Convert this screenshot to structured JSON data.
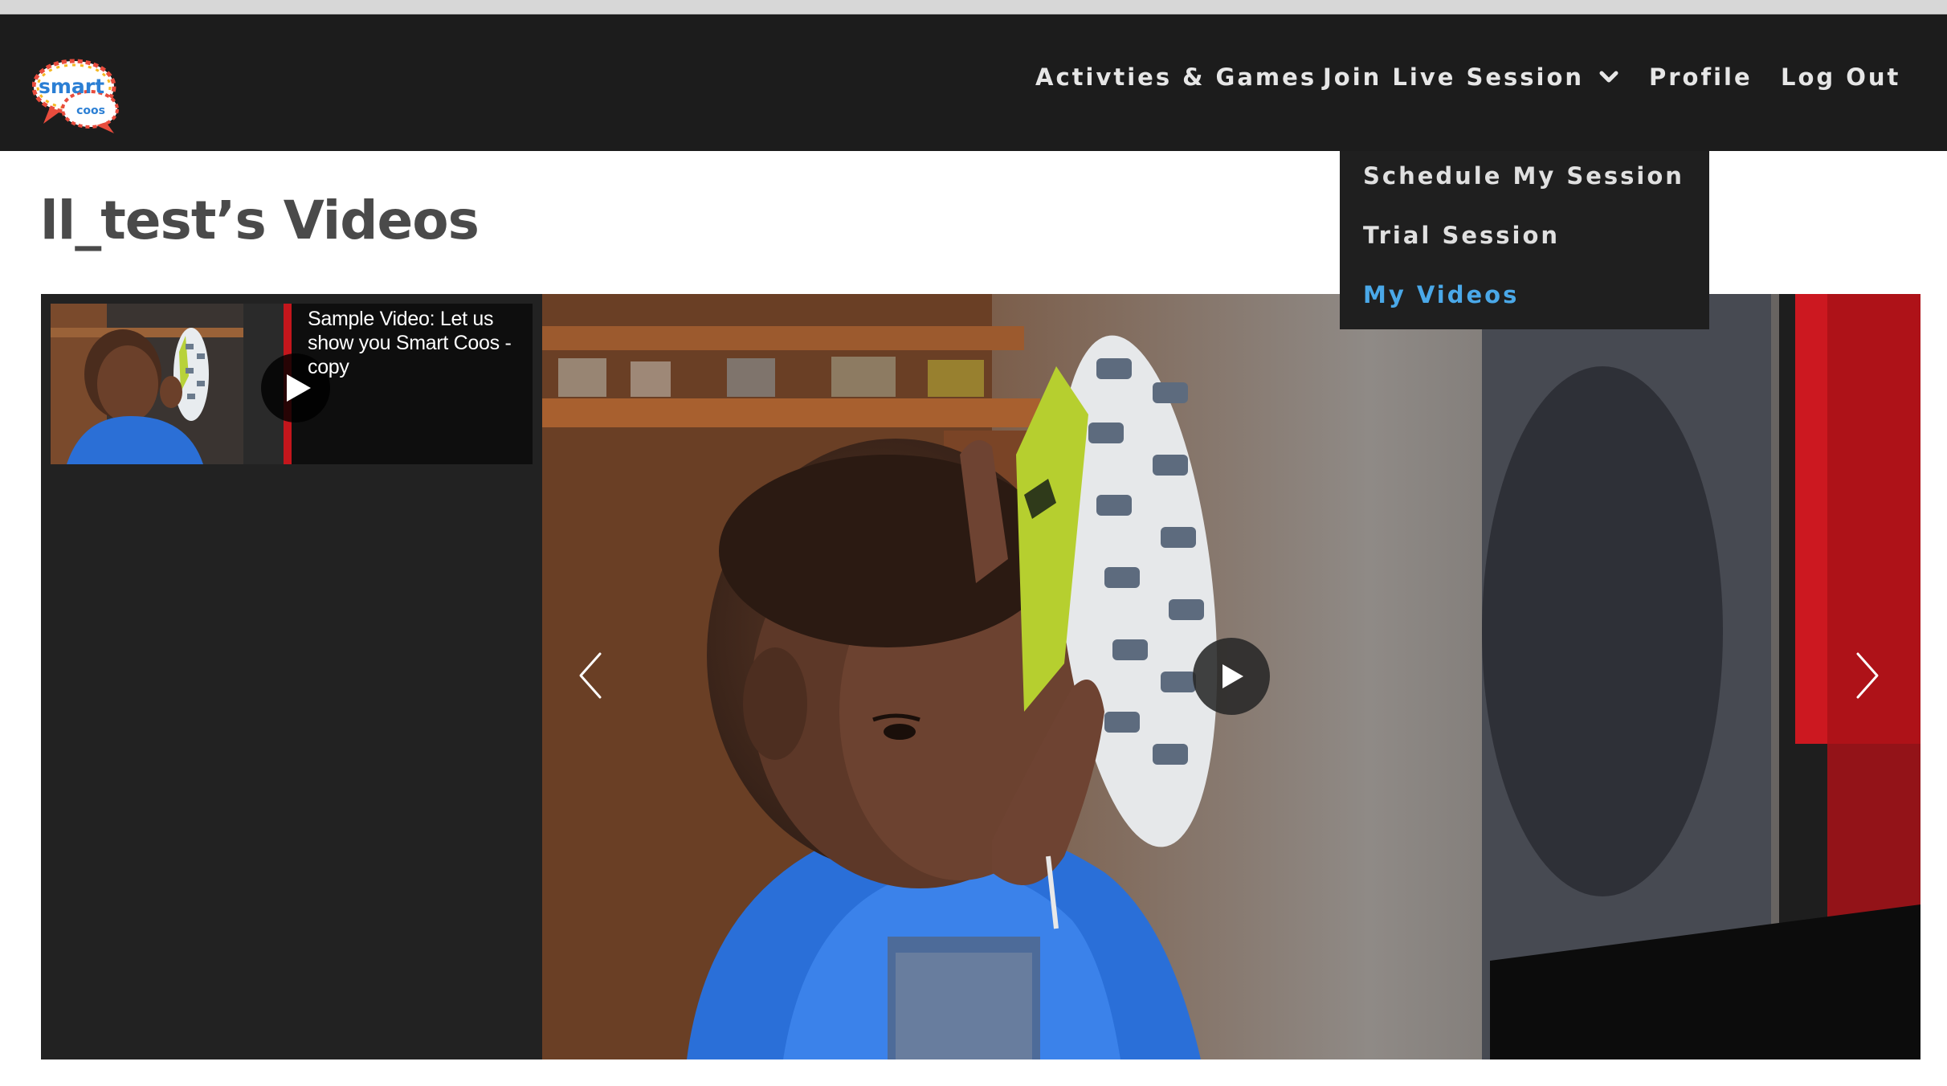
{
  "logo": {
    "text_top": "smart",
    "text_bottom": "coos"
  },
  "nav": {
    "activities_label": "Activties & Games",
    "join_label": "Join Live Session",
    "profile_label": "Profile",
    "logout_label": "Log Out"
  },
  "dropdown": {
    "items": [
      {
        "label": "Schedule My Session"
      },
      {
        "label": "Trial Session"
      },
      {
        "label": "My Videos",
        "active": true
      }
    ]
  },
  "page": {
    "title": "ll_test’s Videos"
  },
  "playlist": {
    "items": [
      {
        "title": "Sample Video: Let us show you Smart Coos - copy"
      }
    ]
  },
  "colors": {
    "nav_bg": "#1c1c1c",
    "active_link": "#4aa8e8",
    "title_text": "#4a4a4a",
    "player_bg": "#202020"
  },
  "icons": {
    "dropdown": "chevron-down-icon",
    "play": "play-icon",
    "prev": "chevron-left-icon",
    "next": "chevron-right-icon"
  }
}
